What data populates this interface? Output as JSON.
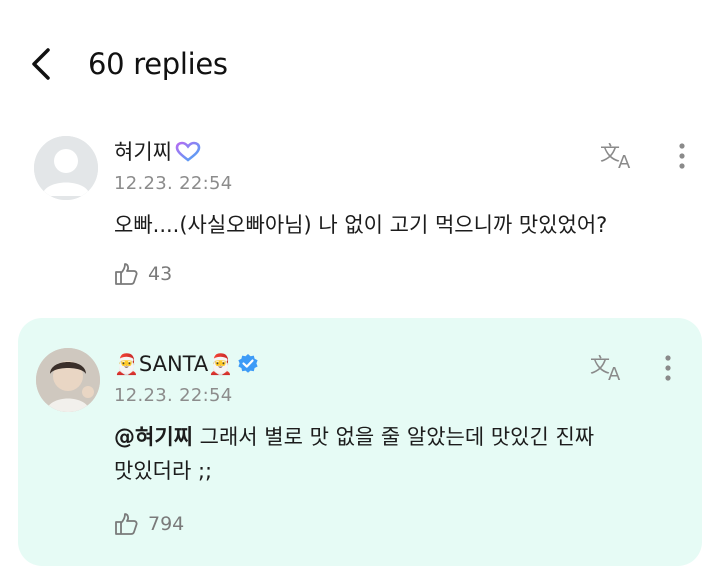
{
  "header": {
    "title": "60 replies",
    "back_icon": "chevron-left-icon"
  },
  "comments": [
    {
      "author": "혀기찌",
      "author_badge_icon": "heart-ring-badge-icon",
      "timestamp": "12.23. 22:54",
      "text": "오빠....(사실오빠아님) 나 없이 고기 먹으니까 맛있었어?",
      "likes": "43",
      "highlighted": false
    },
    {
      "author_prefix_emoji": "🎅",
      "author": "SANTA",
      "author_suffix_emoji": "🎅",
      "verified_icon": "verified-badge-icon",
      "timestamp": "12.23. 22:54",
      "mention": "@혀기찌",
      "text_line1": " 그래서 별로 맛 없을 줄 알았는데 맛있긴 진짜",
      "text_line2": "맛있더라 ;;",
      "likes": "794",
      "highlighted": true,
      "highlight_color": "#e6fbf5"
    }
  ],
  "colors": {
    "timestamp": "#8c8c8c",
    "likes": "#7a7a7a",
    "verified": "#3d9bf7"
  }
}
